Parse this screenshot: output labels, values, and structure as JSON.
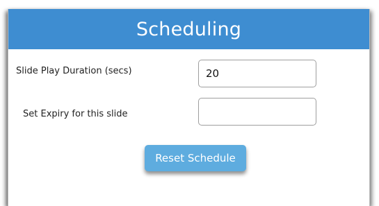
{
  "header": {
    "title": "Scheduling"
  },
  "form": {
    "duration_label": "Slide Play Duration (secs)",
    "duration_value": "20",
    "expiry_label": "Set Expiry for this slide",
    "expiry_value": ""
  },
  "actions": {
    "reset_label": "Reset Schedule"
  },
  "colors": {
    "header_bg": "#3e8dd1",
    "button_bg": "#5eacdf"
  }
}
